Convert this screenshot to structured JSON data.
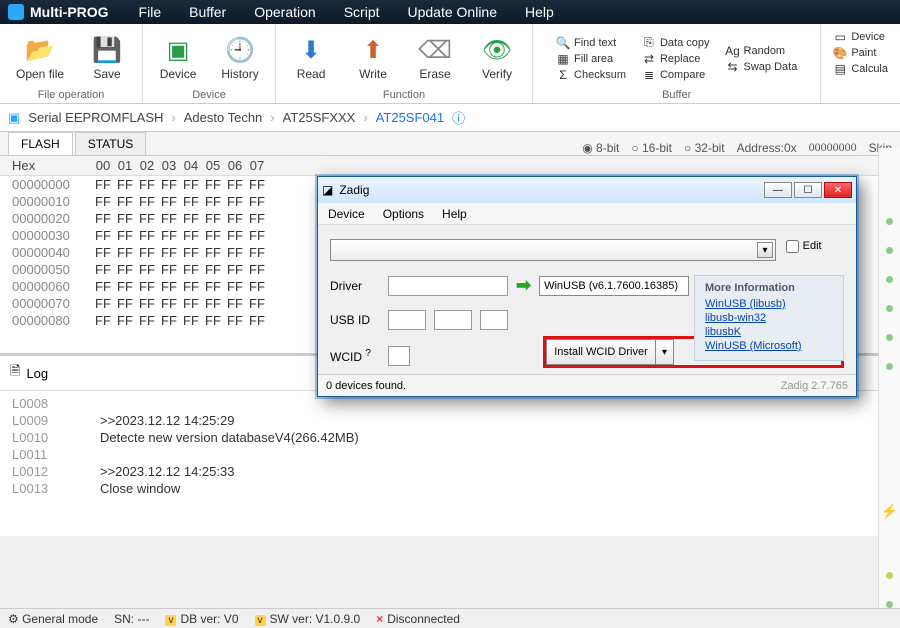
{
  "app": {
    "name": "Multi-PROG"
  },
  "menu": [
    "File",
    "Buffer",
    "Operation",
    "Script",
    "Update Online",
    "Help"
  ],
  "ribbon": {
    "file_operation": {
      "title": "File operation",
      "open": "Open file",
      "save": "Save"
    },
    "device": {
      "title": "Device",
      "device": "Device",
      "history": "History"
    },
    "function": {
      "title": "Function",
      "read": "Read",
      "write": "Write",
      "erase": "Erase",
      "verify": "Verify"
    },
    "buffer": {
      "title": "Buffer",
      "col1": {
        "find": "Find text",
        "fill": "Fill area",
        "checksum": "Checksum"
      },
      "col2": {
        "copy": "Data copy",
        "replace": "Replace",
        "compare": "Compare"
      },
      "col3": {
        "random": "Random",
        "swap": "Swap Data"
      }
    },
    "rightcol": {
      "device": "Device",
      "paint": "Paint",
      "calc": "Calcula"
    }
  },
  "breadcrumb": {
    "items": [
      "Serial EEPROMFLASH",
      "Adesto Techn",
      "AT25SFXXX"
    ],
    "active": "AT25SF041"
  },
  "tabs": {
    "flash": "FLASH",
    "status": "STATUS"
  },
  "opts": {
    "b8": "8-bit",
    "b16": "16-bit",
    "b32": "32-bit",
    "addr_label": "Address:0x",
    "addr_val": "00000000",
    "skip": "Skip"
  },
  "hex": {
    "header": "Hex",
    "cols": [
      "00",
      "01",
      "02",
      "03",
      "04",
      "05",
      "06",
      "07"
    ],
    "rows": [
      {
        "addr": "00000000",
        "bytes": [
          "FF",
          "FF",
          "FF",
          "FF",
          "FF",
          "FF",
          "FF",
          "FF"
        ]
      },
      {
        "addr": "00000010",
        "bytes": [
          "FF",
          "FF",
          "FF",
          "FF",
          "FF",
          "FF",
          "FF",
          "FF"
        ]
      },
      {
        "addr": "00000020",
        "bytes": [
          "FF",
          "FF",
          "FF",
          "FF",
          "FF",
          "FF",
          "FF",
          "FF"
        ]
      },
      {
        "addr": "00000030",
        "bytes": [
          "FF",
          "FF",
          "FF",
          "FF",
          "FF",
          "FF",
          "FF",
          "FF"
        ]
      },
      {
        "addr": "00000040",
        "bytes": [
          "FF",
          "FF",
          "FF",
          "FF",
          "FF",
          "FF",
          "FF",
          "FF"
        ]
      },
      {
        "addr": "00000050",
        "bytes": [
          "FF",
          "FF",
          "FF",
          "FF",
          "FF",
          "FF",
          "FF",
          "FF"
        ]
      },
      {
        "addr": "00000060",
        "bytes": [
          "FF",
          "FF",
          "FF",
          "FF",
          "FF",
          "FF",
          "FF",
          "FF"
        ]
      },
      {
        "addr": "00000070",
        "bytes": [
          "FF",
          "FF",
          "FF",
          "FF",
          "FF",
          "FF",
          "FF",
          "FF"
        ]
      },
      {
        "addr": "00000080",
        "bytes": [
          "FF",
          "FF",
          "FF",
          "FF",
          "FF",
          "FF",
          "FF",
          "FF"
        ]
      }
    ]
  },
  "log": {
    "title": "Log",
    "lines": [
      {
        "n": "L0008",
        "t": ""
      },
      {
        "n": "L0009",
        "t": ">>2023.12.12 14:25:29"
      },
      {
        "n": "L0010",
        "t": "Detecte new version databaseV4(266.42MB)"
      },
      {
        "n": "L0011",
        "t": ""
      },
      {
        "n": "L0012",
        "t": ">>2023.12.12 14:25:33"
      },
      {
        "n": "L0013",
        "t": "Close window"
      }
    ]
  },
  "status": {
    "mode": "General mode",
    "sn": "SN:  --- ",
    "db": "DB ver: V0",
    "sw": "SW ver: V1.0.9.0",
    "conn": "Disconnected"
  },
  "zadig": {
    "title": "Zadig",
    "menu": [
      "Device",
      "Options",
      "Help"
    ],
    "edit": "Edit",
    "driver_label": "Driver",
    "usbid_label": "USB ID",
    "wcid_label": "WCID",
    "wcid_q": "?",
    "winusb": "WinUSB (v6.1.7600.16385)",
    "install": "Install WCID Driver",
    "more_header": "More Information",
    "links": [
      "WinUSB (libusb)",
      "libusb-win32",
      "libusbK",
      "WinUSB (Microsoft)"
    ],
    "status_left": "0 devices found.",
    "status_right": "Zadig 2.7.765"
  }
}
